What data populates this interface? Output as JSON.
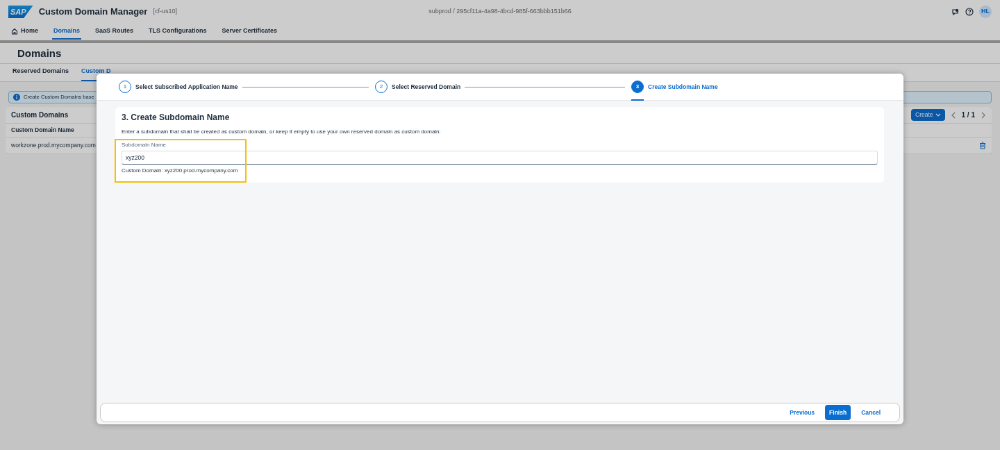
{
  "app": {
    "logo": "SAP",
    "title": "Custom Domain Manager",
    "landscape": "[cf-us10]",
    "context": "subprod / 295cf11a-4a98-4bcd-985f-663bbb151b66",
    "avatar": "HL"
  },
  "nav": [
    {
      "label": "Home",
      "selected": false
    },
    {
      "label": "Domains",
      "selected": true
    },
    {
      "label": "SaaS Routes",
      "selected": false
    },
    {
      "label": "TLS Configurations",
      "selected": false
    },
    {
      "label": "Server Certificates",
      "selected": false
    }
  ],
  "page_title": "Domains",
  "page_tabs": [
    {
      "label": "Reserved Domains",
      "selected": false
    },
    {
      "label": "Custom D",
      "selected": true
    }
  ],
  "info_message": "Create Custom Domains base",
  "table": {
    "title": "Custom Domains",
    "create_button": "Create",
    "pager": "1 / 1",
    "columns": [
      "Custom Domain Name"
    ],
    "rows": [
      [
        "workzone.prod.mycompany.com"
      ]
    ]
  },
  "wizard": {
    "steps": [
      {
        "number": "1",
        "label": "Select Subscribed Application Name",
        "selected": false
      },
      {
        "number": "2",
        "label": "Select Reserved Domain",
        "selected": false
      },
      {
        "number": "3",
        "label": "Create Subdomain Name",
        "selected": true
      }
    ],
    "section_title": "3. Create Subdomain Name",
    "instruction": "Enter a subdomain that shall be created as custom domain, or keep it empty to use your own reserved domain as custom domain:",
    "field": {
      "label": "Subdomain Name",
      "value": "xyz200"
    },
    "hint": "Custom Domain: xyz200.prod.mycompany.com",
    "highlighted": true,
    "buttons": [
      {
        "label": "Previous",
        "kind": "link"
      },
      {
        "label": "Finish",
        "kind": "primary"
      },
      {
        "label": "Cancel",
        "kind": "link"
      }
    ]
  }
}
